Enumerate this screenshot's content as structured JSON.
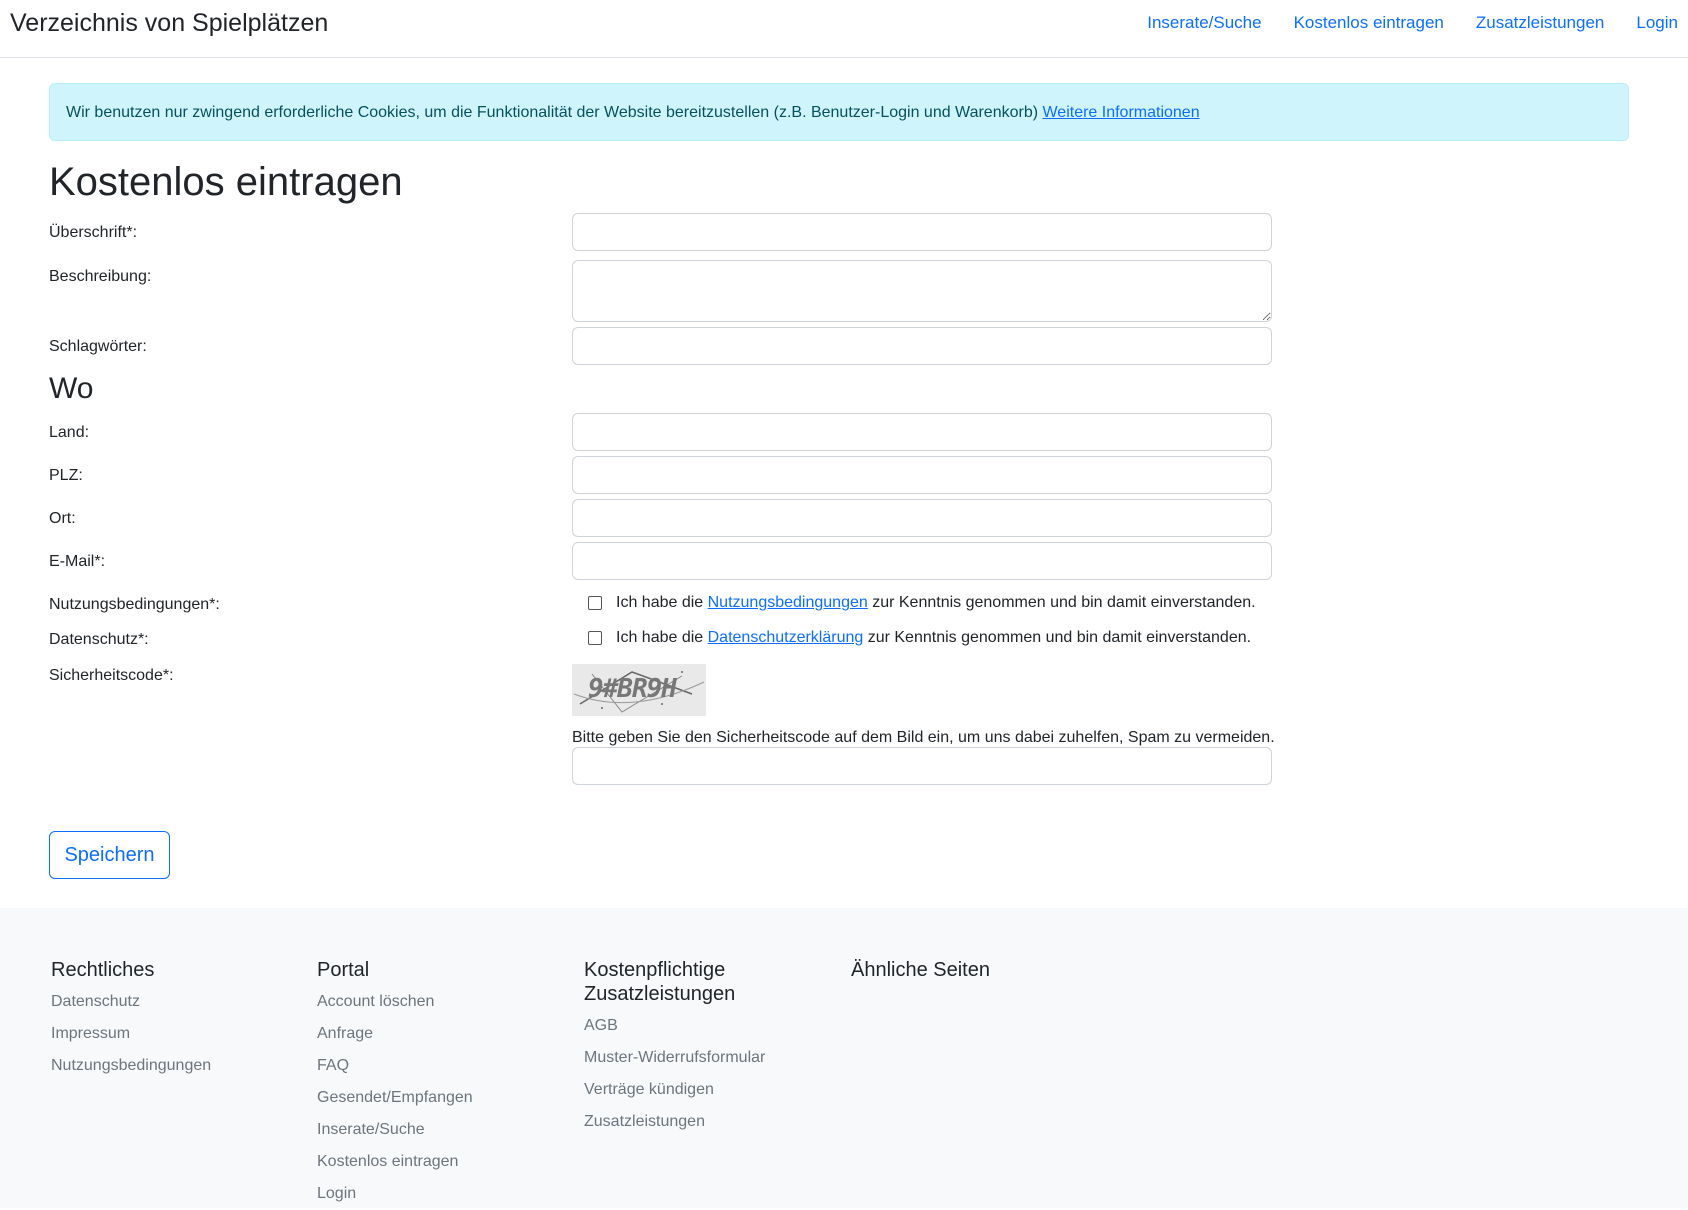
{
  "navbar": {
    "brand": "Verzeichnis von Spielplätzen",
    "links": [
      "Inserate/Suche",
      "Kostenlos eintragen",
      "Zusatzleistungen",
      "Login"
    ]
  },
  "cookie_alert": {
    "text": "Wir benutzen nur zwingend erforderliche Cookies, um die Funktionalität der Website bereitzustellen (z.B. Benutzer-Login und Warenkorb) ",
    "link": "Weitere Informationen"
  },
  "page_title": "Kostenlos eintragen",
  "form": {
    "ueberschrift_label": "Überschrift*:",
    "beschreibung_label": "Beschreibung:",
    "schlagwoerter_label": "Schlagwörter:",
    "section_wo": "Wo",
    "land_label": "Land:",
    "plz_label": "PLZ:",
    "ort_label": "Ort:",
    "email_label": "E-Mail*:",
    "nutzungsbedingungen_label": "Nutzungsbedingungen*:",
    "datenschutz_label": "Datenschutz*:",
    "sicherheitscode_label": "Sicherheitscode*:",
    "terms_prefix": "Ich habe die ",
    "terms_link": "Nutzungsbedingungen",
    "terms_suffix": " zur Kenntnis genommen und bin damit einverstanden.",
    "privacy_prefix": "Ich habe die ",
    "privacy_link": "Datenschutzerklärung",
    "privacy_suffix": " zur Kenntnis genommen und bin damit einverstanden.",
    "captcha_text": "9#BR9H",
    "captcha_hint": "Bitte geben Sie den Sicherheitscode auf dem Bild ein, um uns dabei zuhelfen, Spam zu vermeiden.",
    "save_label": "Speichern"
  },
  "footer": {
    "rechtliches": {
      "title": "Rechtliches",
      "links": [
        "Datenschutz",
        "Impressum",
        "Nutzungsbedingungen"
      ]
    },
    "portal": {
      "title": "Portal",
      "links": [
        "Account löschen",
        "Anfrage",
        "FAQ",
        "Gesendet/Empfangen",
        "Inserate/Suche",
        "Kostenlos eintragen",
        "Login"
      ]
    },
    "kostenpflichtig": {
      "title": "Kostenpflichtige Zusatzleistungen",
      "links": [
        "AGB",
        "Muster-Widerrufsformular",
        "Verträge kündigen",
        "Zusatzleistungen"
      ]
    },
    "aehnlich": {
      "title": "Ähnliche Seiten"
    }
  }
}
